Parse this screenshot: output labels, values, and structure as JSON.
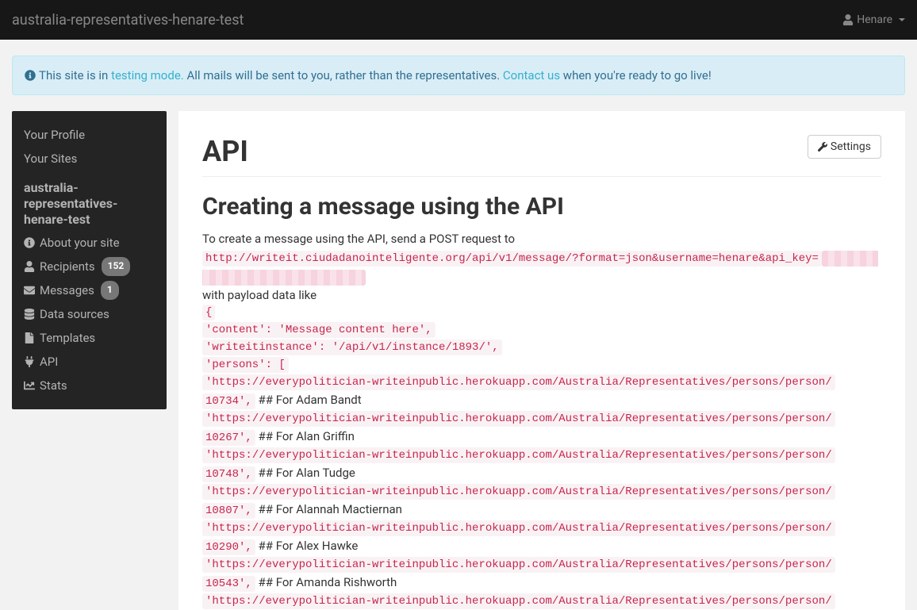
{
  "navbar": {
    "brand": "australia-representatives-henare-test",
    "user": "Henare"
  },
  "alert": {
    "prefix": "This site is in ",
    "testing_link": "testing mode.",
    "middle": " All mails will be sent to you, rather than the representatives. ",
    "contact_link": "Contact us",
    "suffix": " when you're ready to go live!"
  },
  "sidebar": {
    "profile": "Your Profile",
    "sites": "Your Sites",
    "site_name": "australia-representatives-henare-test",
    "about": "About your site",
    "recipients": "Recipients",
    "recipients_count": "152",
    "messages": "Messages",
    "messages_count": "1",
    "data_sources": "Data sources",
    "templates": "Templates",
    "api": "API",
    "stats": "Stats"
  },
  "main": {
    "title": "API",
    "settings_btn": "Settings",
    "section_title": "Creating a message using the API",
    "intro": "To create a message using the API, send a POST request to",
    "endpoint": "http://writeit.ciudadanointeligente.org/api/v1/message/?format=json&username=henare&api_key=",
    "redacted_key": "################################",
    "payload_intro": "with payload data like",
    "code": {
      "open": "{",
      "content": "    'content': 'Message content here',",
      "instance": "    'writeitinstance': '/api/v1/instance/1893/',",
      "persons_open": "    'persons': [",
      "url_base": "        'https://everypolitician-writeinpublic.herokuapp.com/Australia/Representatives/persons/person/",
      "p1_id": "10734',",
      "p1_name": " ## For Adam Bandt",
      "p2_id": "10267',",
      "p2_name": " ## For Alan Griffin",
      "p3_id": "10748',",
      "p3_name": " ## For Alan Tudge",
      "p4_id": "10807',",
      "p4_name": " ## For Alannah Mactiernan",
      "p5_id": "10290',",
      "p5_name": " ## For Alex Hawke",
      "p6_id": "10543',",
      "p6_name": " ## For Amanda Rishworth"
    }
  }
}
